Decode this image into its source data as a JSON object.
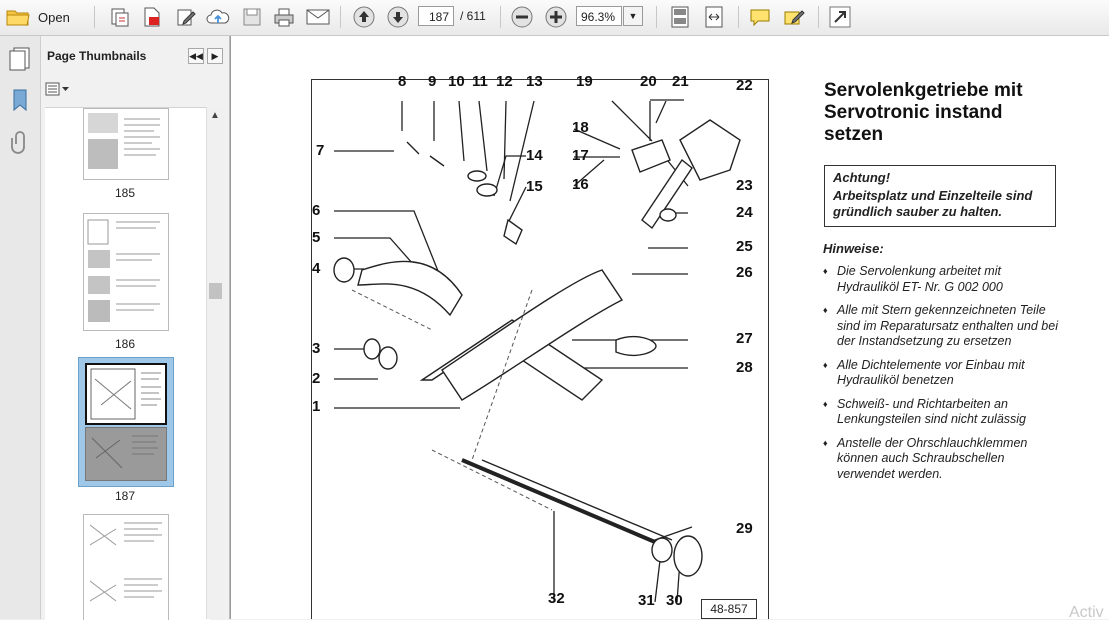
{
  "toolbar": {
    "open_label": "Open",
    "current_page": "187",
    "total_pages": "/ 611",
    "zoom": "96.3%"
  },
  "thumbnails_panel": {
    "title": "Page Thumbnails",
    "pages": [
      {
        "label": "185",
        "selected": false
      },
      {
        "label": "186",
        "selected": false
      },
      {
        "label": "187",
        "selected": true
      },
      {
        "label": "",
        "selected": false
      }
    ]
  },
  "document": {
    "title_lines": [
      "Servolenkgetriebe mit",
      "Servotronic instand",
      "setzen"
    ],
    "warning_heading": "Achtung!",
    "warning_text": "Arbeitsplatz und Einzelteile sind gründlich sauber zu halten.",
    "hints_heading": "Hinweise:",
    "hints": [
      "Die Servolenkung arbeitet mit Hydrauliköl ET- Nr. G 002 000",
      "Alle mit Stern gekennzeichneten Teile sind im Reparatursatz enthalten und bei der Instandsetzung zu ersetzen",
      "Alle Dichtelemente vor Einbau mit Hydrauliköl benetzen",
      "Schweiß- und Richtarbeiten an Lenkungsteilen sind nicht zulässig",
      "Anstelle der Ohrschlauchklemmen können auch Schraubschellen verwendet werden."
    ],
    "figure_number": "48-857",
    "part_numbers": [
      "1",
      "2",
      "3",
      "4",
      "5",
      "6",
      "7",
      "8",
      "9",
      "10",
      "11",
      "12",
      "13",
      "14",
      "15",
      "16",
      "17",
      "18",
      "19",
      "20",
      "21",
      "22",
      "23",
      "24",
      "25",
      "26",
      "27",
      "28",
      "29",
      "30",
      "31",
      "32"
    ],
    "watermark": "Activ"
  }
}
